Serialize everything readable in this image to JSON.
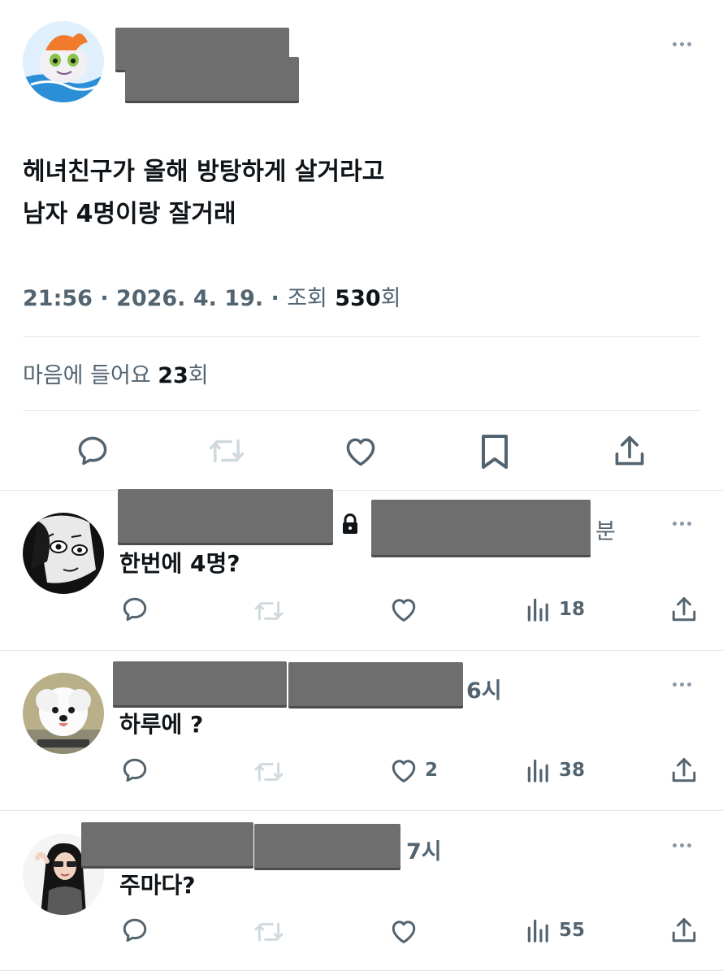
{
  "post": {
    "text_line1": "헤녀친구가 올해 방탕하게 살거라고",
    "text_line2": "남자 4명이랑 잘거래",
    "time": "21:56",
    "date": "2026. 4. 19.",
    "views_label": "조회",
    "views_count": "530",
    "views_unit": "회",
    "likes_label": "마음에 들어요",
    "likes_count": "23",
    "likes_unit": "회",
    "separator": "·"
  },
  "replies": [
    {
      "time": "분",
      "text": "한번에 4명?",
      "likes": "",
      "views": "18"
    },
    {
      "time": "6시",
      "text": "하루에 ?",
      "likes": "2",
      "views": "38"
    },
    {
      "time": "7시",
      "text": "주마다?",
      "likes": "",
      "views": "55"
    }
  ],
  "colors": {
    "icon": "#536471",
    "muted_icon": "#cfd9de",
    "redaction": "#6e6e6e",
    "divider": "#e3e7ea"
  },
  "icons": [
    "reply-icon",
    "retweet-icon",
    "heart-icon",
    "bookmark-icon",
    "share-icon",
    "views-icon",
    "lock-icon",
    "more-icon"
  ]
}
